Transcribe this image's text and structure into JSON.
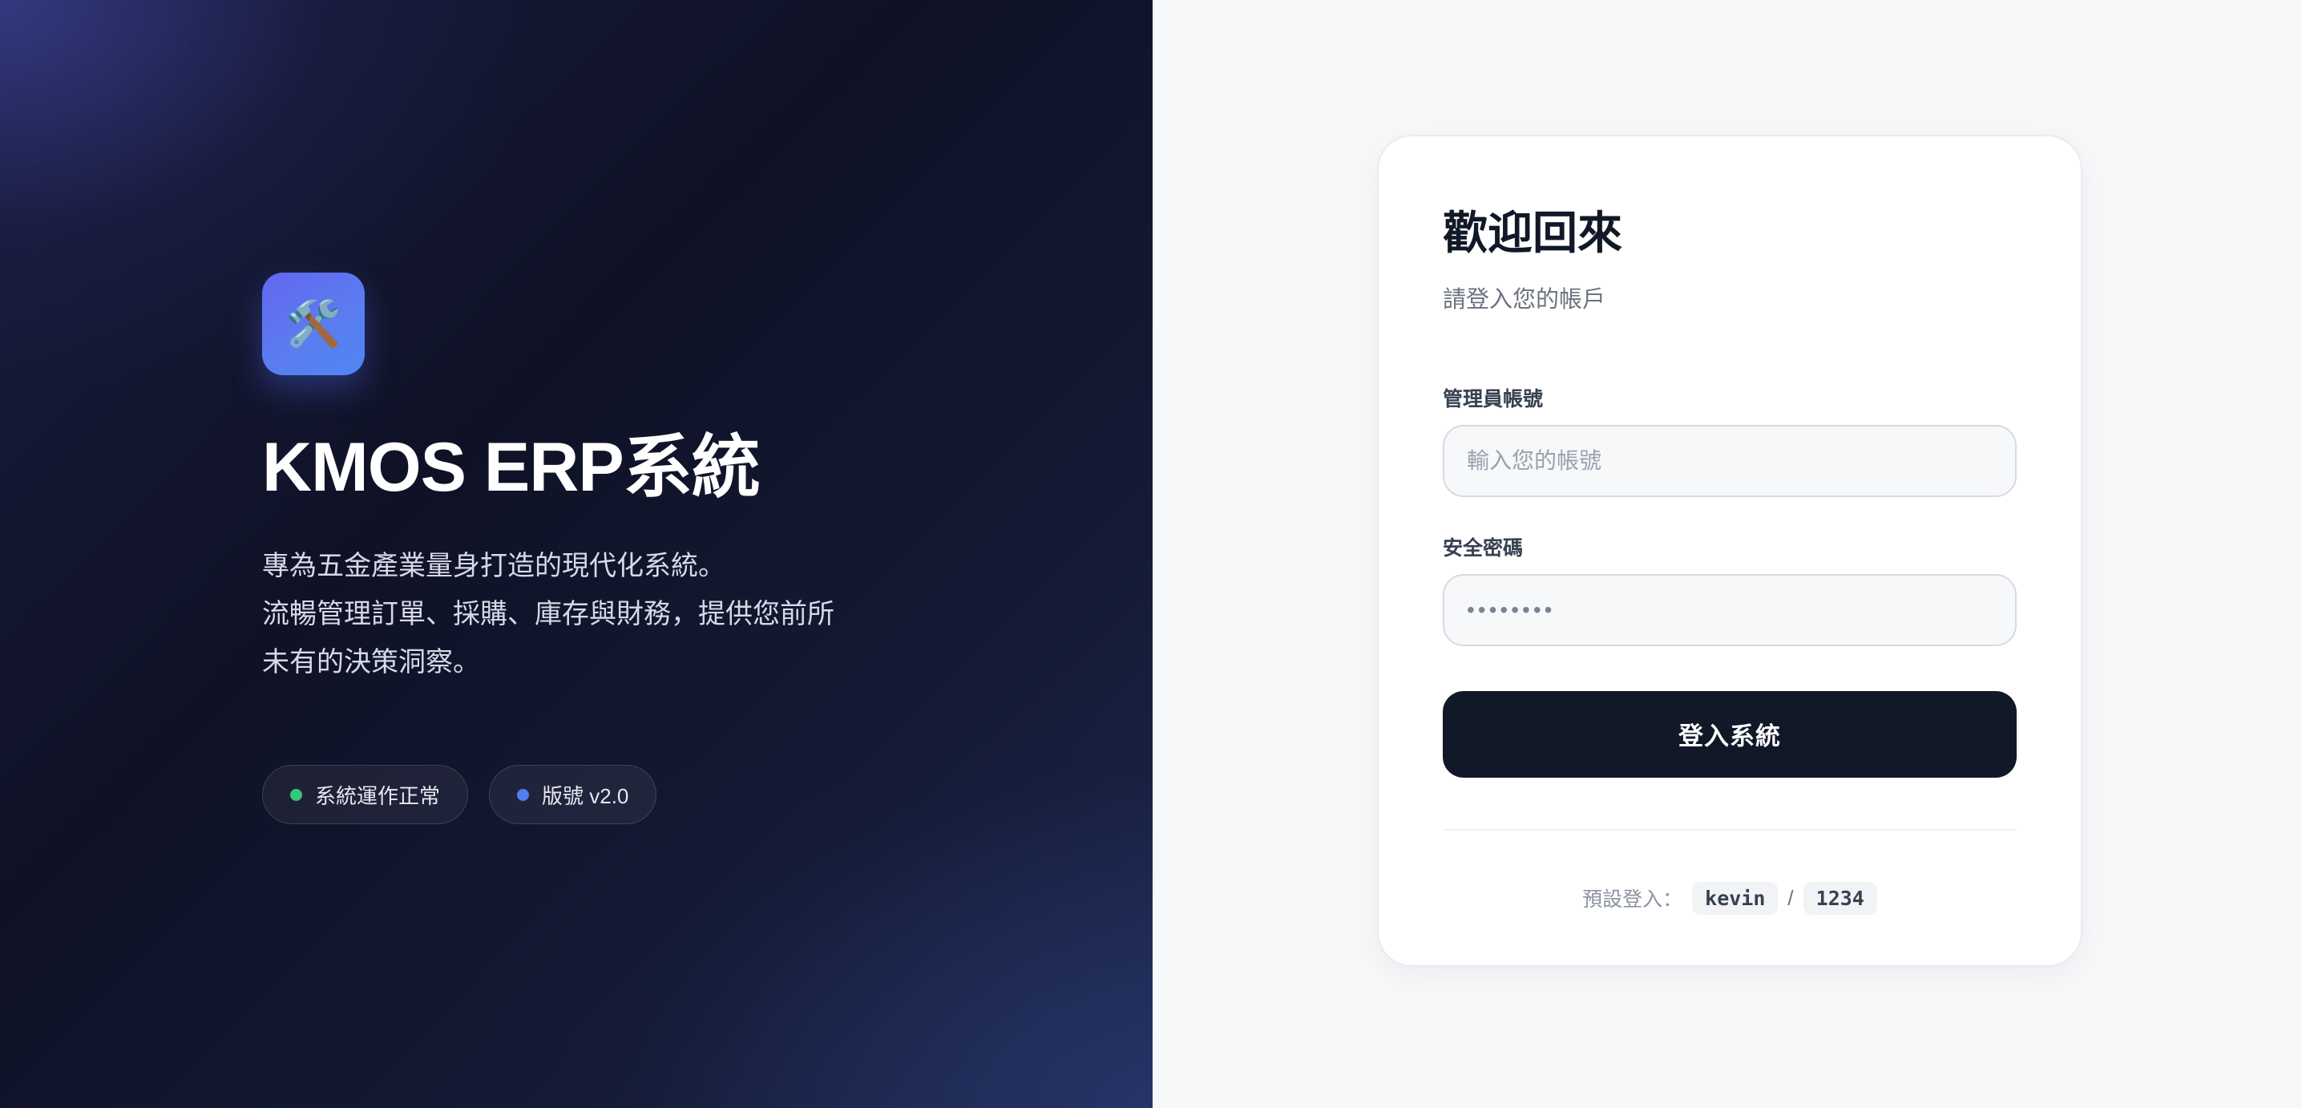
{
  "brand": {
    "logo_icon": "hammer-and-wrench-icon",
    "logo_glyph": "🛠️",
    "title": "KMOS ERP系統",
    "description": "專為五金產業量身打造的現代化系統。\n流暢管理訂單、採購、庫存與財務，提供您前所\n未有的決策洞察。"
  },
  "status_badges": [
    {
      "label": "系統運作正常",
      "color": "#34c77b"
    },
    {
      "label": "版號 v2.0",
      "color": "#4f7df3"
    }
  ],
  "login": {
    "title": "歡迎回來",
    "subtitle": "請登入您的帳戶",
    "account_label": "管理員帳號",
    "account_placeholder": "輸入您的帳號",
    "account_value": "",
    "password_label": "安全密碼",
    "password_placeholder": "••••••••",
    "password_value": "",
    "submit_label": "登入系統",
    "default_prefix": "預設登入：",
    "default_user": "kevin",
    "default_separator": "/",
    "default_password": "1234"
  },
  "colors": {
    "accent": "#5b7cf0",
    "button": "#111827",
    "hero_bg": "#0f1226"
  }
}
